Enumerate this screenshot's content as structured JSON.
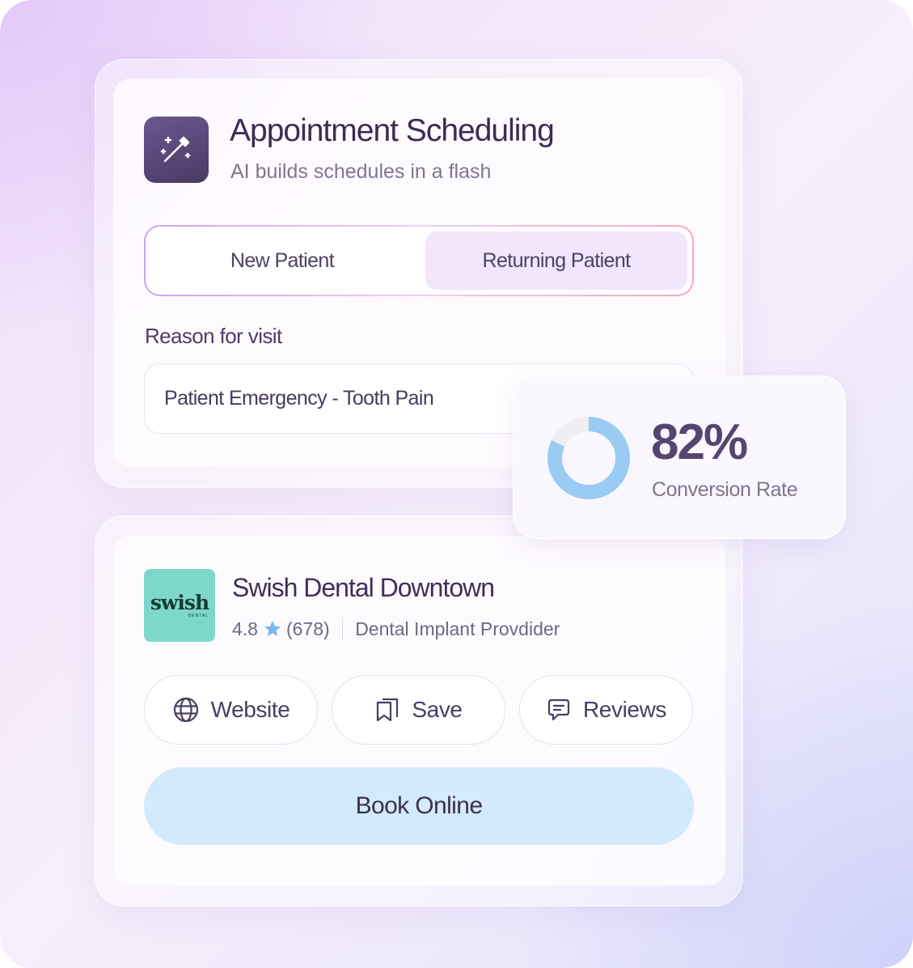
{
  "scheduling": {
    "title": "Appointment Scheduling",
    "subtitle": "AI builds schedules in a flash",
    "icon": "magic-wand-icon",
    "patient_toggle": {
      "options": [
        "New Patient",
        "Returning Patient"
      ],
      "selected": "Returning Patient"
    },
    "reason_label": "Reason for visit",
    "reason_value": "Patient Emergency - Tooth Pain"
  },
  "conversion": {
    "value": "82%",
    "fraction": 0.82,
    "label": "Conversion Rate",
    "ring_color": "#9acbf2",
    "track_color": "#eeeef3"
  },
  "business": {
    "logo_text": "swish",
    "logo_subtext": "DENTAL",
    "logo_color": "#7dd8cb",
    "name": "Swish Dental Downtown",
    "rating": "4.8",
    "review_count": "(678)",
    "category": "Dental Implant Provdider",
    "star_color": "#79b8ee",
    "actions": [
      {
        "label": "Website",
        "icon": "globe-icon"
      },
      {
        "label": "Save",
        "icon": "bookmark-icon"
      },
      {
        "label": "Reviews",
        "icon": "message-icon"
      }
    ],
    "book_label": "Book Online",
    "book_color": "#d3eafc"
  }
}
